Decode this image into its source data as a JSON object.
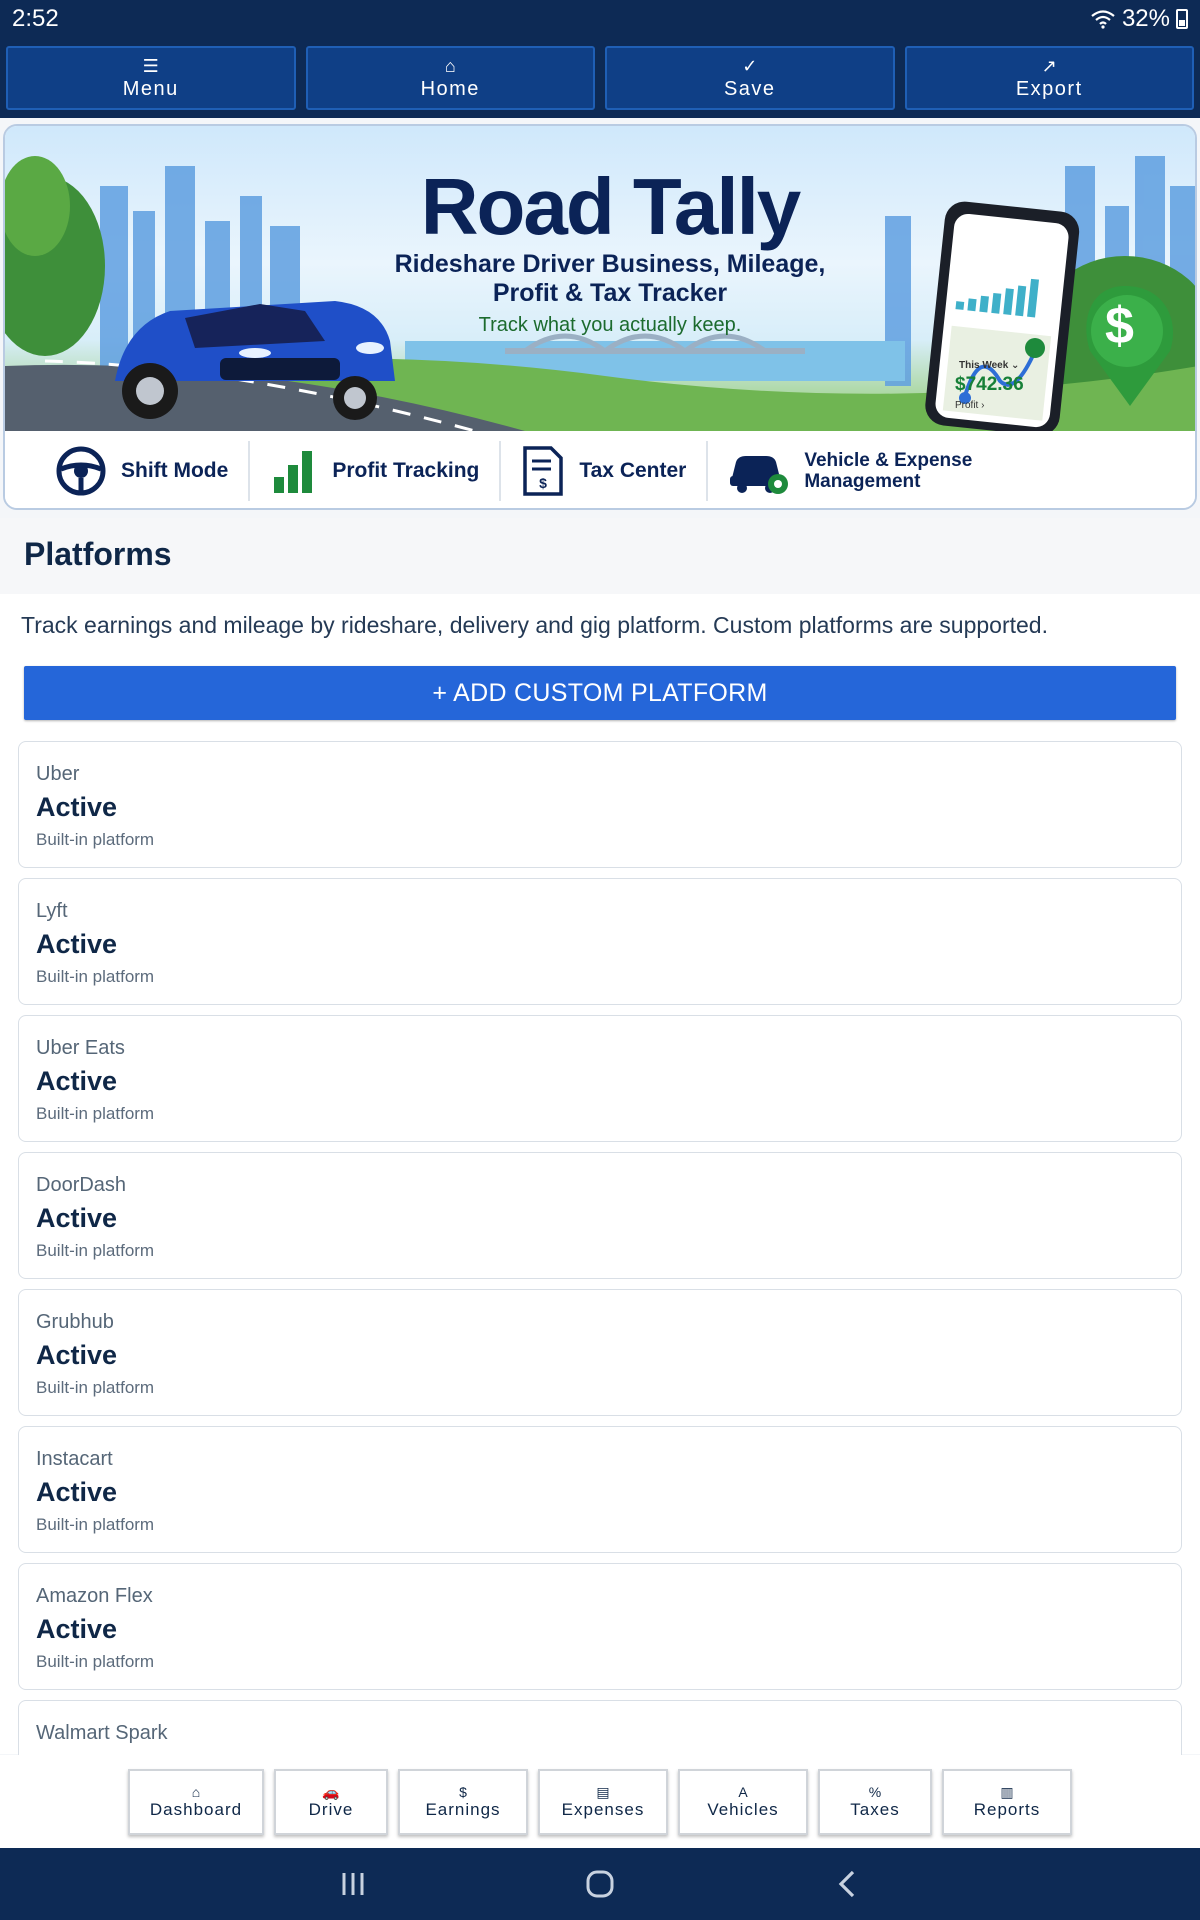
{
  "status_bar": {
    "time": "2:52",
    "battery": "32%"
  },
  "top_toolbar": [
    {
      "icon": "menu-icon",
      "glyph": "☰",
      "label": "Menu"
    },
    {
      "icon": "home-icon",
      "glyph": "⌂",
      "label": "Home"
    },
    {
      "icon": "check-icon",
      "glyph": "✓",
      "label": "Save"
    },
    {
      "icon": "export-icon",
      "glyph": "↗",
      "label": "Export"
    }
  ],
  "hero": {
    "title": "Road Tally",
    "subtitle_line1": "Rideshare Driver Business, Mileage,",
    "subtitle_line2": "Profit & Tax Tracker",
    "tagline": "Track what you actually keep.",
    "phone_week": "This Week ⌄",
    "phone_amount": "$742.36",
    "phone_profit": "Profit ›",
    "pin_symbol": "$",
    "features": [
      {
        "icon": "steering-wheel-icon",
        "label": "Shift Mode"
      },
      {
        "icon": "bar-chart-icon",
        "label": "Profit Tracking"
      },
      {
        "icon": "tax-document-icon",
        "label": "Tax Center"
      },
      {
        "icon": "car-gear-icon",
        "label_line1": "Vehicle & Expense",
        "label_line2": "Management"
      }
    ]
  },
  "page": {
    "title": "Platforms",
    "description": "Track earnings and mileage by rideshare, delivery and gig platform. Custom platforms are supported.",
    "add_button": "+ ADD CUSTOM PLATFORM"
  },
  "platforms": [
    {
      "name": "Uber",
      "status": "Active",
      "type": "Built-in platform"
    },
    {
      "name": "Lyft",
      "status": "Active",
      "type": "Built-in platform"
    },
    {
      "name": "Uber Eats",
      "status": "Active",
      "type": "Built-in platform"
    },
    {
      "name": "DoorDash",
      "status": "Active",
      "type": "Built-in platform"
    },
    {
      "name": "Grubhub",
      "status": "Active",
      "type": "Built-in platform"
    },
    {
      "name": "Instacart",
      "status": "Active",
      "type": "Built-in platform"
    },
    {
      "name": "Amazon Flex",
      "status": "Active",
      "type": "Built-in platform"
    },
    {
      "name": "Walmart Spark",
      "status": "",
      "type": ""
    }
  ],
  "bottom_nav": [
    {
      "icon": "dashboard-icon",
      "glyph": "⌂",
      "label": "Dashboard"
    },
    {
      "icon": "car-icon",
      "glyph": "🚗",
      "label": "Drive"
    },
    {
      "icon": "dollar-icon",
      "glyph": "$",
      "label": "Earnings"
    },
    {
      "icon": "receipt-icon",
      "glyph": "▤",
      "label": "Expenses"
    },
    {
      "icon": "vehicle-icon",
      "glyph": "A",
      "label": "Vehicles"
    },
    {
      "icon": "percent-icon",
      "glyph": "%",
      "label": "Taxes"
    },
    {
      "icon": "reports-icon",
      "glyph": "▥",
      "label": "Reports"
    }
  ],
  "colors": {
    "primary": "#0d2a55",
    "accent": "#2566d9",
    "green": "#178038"
  }
}
